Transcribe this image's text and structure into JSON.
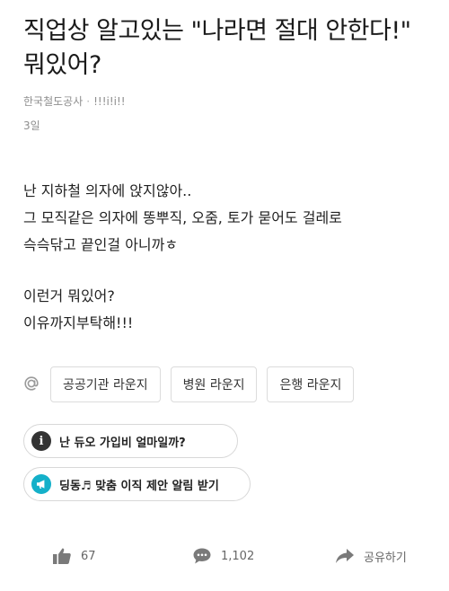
{
  "post": {
    "title": "직업상 알고있는 \"나라면 절대 안한다!\" 뭐있어?",
    "board": "한국철도공사",
    "separator": "·",
    "author": "!!!i!i!!",
    "date": "3일",
    "body_lines": [
      "난 지하철 의자에 앉지않아..",
      "그 모직같은 의자에 똥뿌직, 오줌, 토가 묻어도 걸레로",
      "슥슥닦고 끝인걸 아니까ㅎ",
      "이런거 뭐있어?",
      "이유까지부탁해!!!"
    ]
  },
  "tags": {
    "icon": "at-icon",
    "items": [
      "공공기관 라운지",
      "병원 라운지",
      "은행 라운지"
    ]
  },
  "promos": [
    {
      "icon": "info-icon",
      "icon_glyph": "i",
      "label": "난 듀오 가입비 얼마일까?"
    },
    {
      "icon": "megaphone-icon",
      "label": "딩동♬ 맞춤 이직 제안 알림 받기"
    }
  ],
  "actions": {
    "like_count": "67",
    "comment_count": "1,102",
    "share_label": "공유하기"
  },
  "colors": {
    "accent": "#14b0c9",
    "muted_text": "#8e8e8e",
    "icon_gray": "#9a9a9a"
  }
}
